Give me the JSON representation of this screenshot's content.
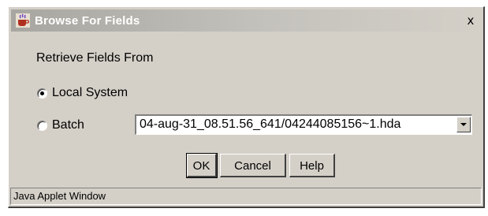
{
  "window": {
    "title": "Browse For Fields",
    "close_glyph": "x",
    "app_icon": "java-coffee-icon"
  },
  "form": {
    "section_label": "Retrieve Fields From",
    "options": [
      {
        "label": "Local System",
        "selected": true
      },
      {
        "label": "Batch",
        "selected": false
      }
    ],
    "batch_value": "04-aug-31_08.51.56_641/04244085156~1.hda"
  },
  "buttons": {
    "ok": "OK",
    "cancel": "Cancel",
    "help": "Help"
  },
  "status": {
    "text": "Java Applet Window"
  }
}
